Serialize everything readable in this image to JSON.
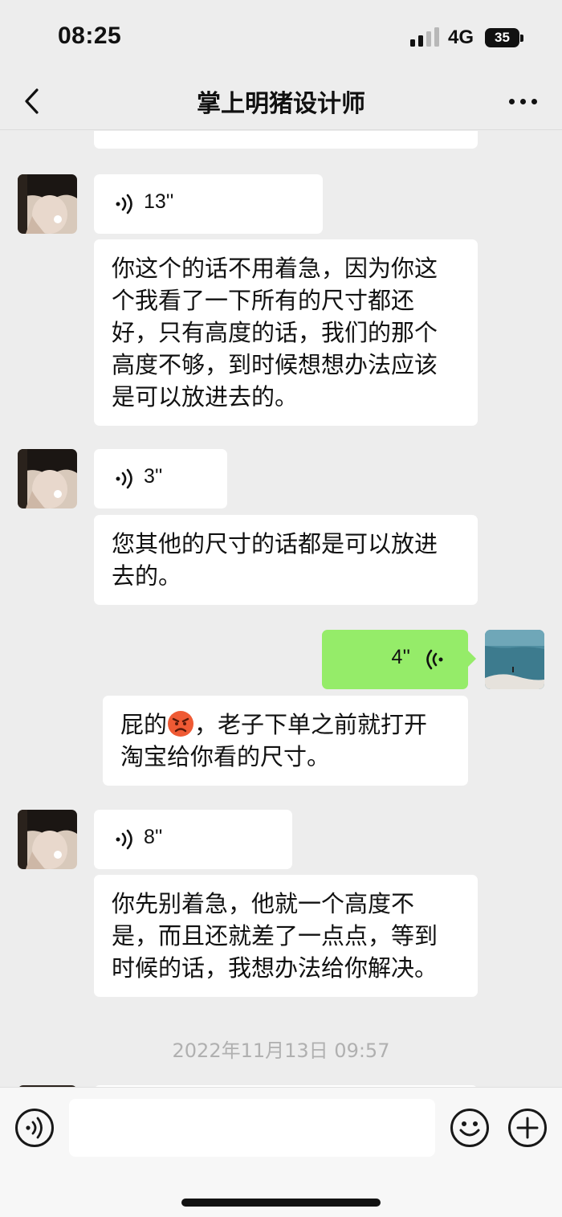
{
  "status_bar": {
    "time": "08:25",
    "network": "4G",
    "battery": "35"
  },
  "nav": {
    "title": "掌上明猪设计师",
    "back_icon": "chevron-left-icon",
    "more_icon": "more-dots-icon"
  },
  "messages": {
    "voice_1": "13''",
    "text_1": "你这个的话不用着急，因为你这个我看了一下所有的尺寸都还好，只有高度的话，我们的那个高度不够，到时候想想办法应该是可以放进去的。",
    "voice_2": "3''",
    "text_2": "您其他的尺寸的话都是可以放进去的。",
    "voice_me": "4''",
    "text_me_before": "屁的",
    "text_me_emoji": "angry-face-emoji",
    "text_me_after": "，老子下单之前就打开淘宝给你看的尺寸。",
    "voice_3": "8''",
    "text_3": "你先别着急，他就一个高度不是，而且还就差了一点点，等到时候的话，我想办法给你解决。",
    "timestamp": "2022年11月13日 09:57"
  },
  "input_bar": {
    "voice_icon": "voice-input-icon",
    "emoji_icon": "emoji-smile-icon",
    "plus_icon": "plus-circle-icon",
    "text_value": ""
  },
  "colors": {
    "background": "#ededed",
    "my_bubble": "#95ec69",
    "their_bubble": "#ffffff",
    "timestamp": "#b0b0b0"
  }
}
